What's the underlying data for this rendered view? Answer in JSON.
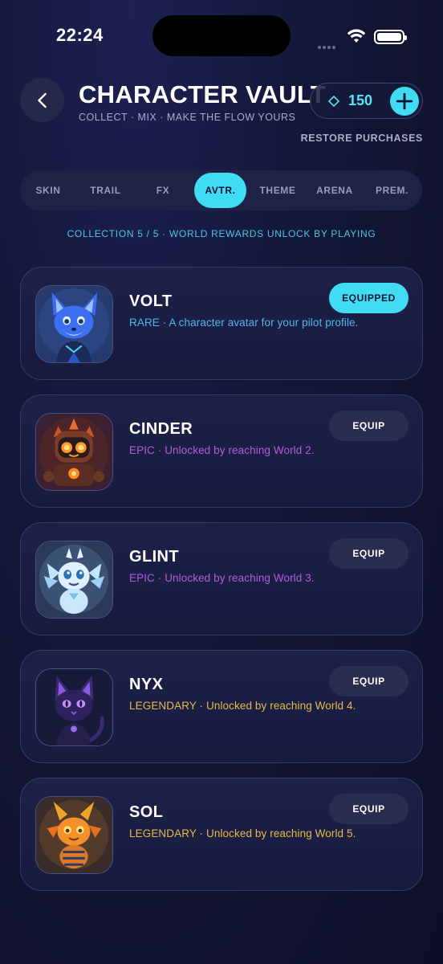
{
  "status_bar": {
    "time": "22:24"
  },
  "header": {
    "title": "CHARACTER VAULT",
    "subtitle": "COLLECT · MIX · MAKE THE FLOW YOURS",
    "coins": "150",
    "restore_label": "RESTORE PURCHASES"
  },
  "tabs": [
    {
      "label": "SKIN"
    },
    {
      "label": "TRAIL"
    },
    {
      "label": "FX"
    },
    {
      "label": "AVTR.",
      "active": true
    },
    {
      "label": "THEME"
    },
    {
      "label": "ARENA"
    },
    {
      "label": "PREM."
    }
  ],
  "collection": {
    "text": "COLLECTION  5 / 5  ·  WORLD REWARDS UNLOCK BY PLAYING"
  },
  "colors": {
    "accent": "#3fdcf4",
    "rare": "#4fb8f0",
    "epic": "#b45be0",
    "legendary": "#e9b84c"
  },
  "characters": [
    {
      "name": "VOLT",
      "desc": "RARE · A character avatar for your pilot profile.",
      "rarity": "rare",
      "action": "EQUIPPED",
      "equipped": true
    },
    {
      "name": "CINDER",
      "desc": "EPIC · Unlocked by reaching World 2.",
      "rarity": "epic",
      "action": "EQUIP",
      "equipped": false
    },
    {
      "name": "GLINT",
      "desc": "EPIC · Unlocked by reaching World 3.",
      "rarity": "epic",
      "action": "EQUIP",
      "equipped": false
    },
    {
      "name": "NYX",
      "desc": "LEGENDARY · Unlocked by reaching World 4.",
      "rarity": "legendary",
      "action": "EQUIP",
      "equipped": false
    },
    {
      "name": "SOL",
      "desc": "LEGENDARY · Unlocked by reaching World 5.",
      "rarity": "legendary",
      "action": "EQUIP",
      "equipped": false
    }
  ]
}
